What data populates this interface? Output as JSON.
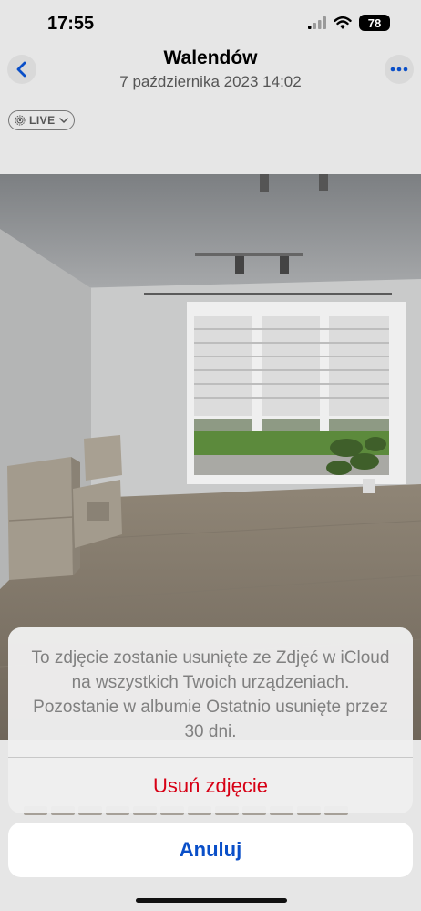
{
  "status_bar": {
    "time": "17:55",
    "battery": "78"
  },
  "header": {
    "title": "Walendów",
    "subtitle": "7 października 2023  14:02",
    "live_badge": "LIVE"
  },
  "photo": {
    "description_icon": "room-photo"
  },
  "action_sheet": {
    "message": "To zdjęcie zostanie usunięte ze Zdjęć w iCloud na wszystkich Twoich urządzeniach. Pozostanie w albumie Ostatnio usunięte przez 30 dni.",
    "delete_label": "Usuń zdjęcie",
    "cancel_label": "Anuluj"
  },
  "colors": {
    "destructive": "#d70015",
    "accent": "#0a4fc8"
  }
}
